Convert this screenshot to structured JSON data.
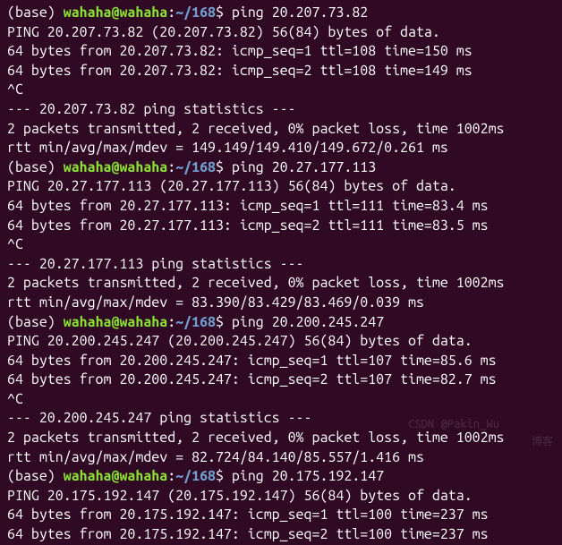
{
  "prompt": {
    "env": "(base) ",
    "user": "wahaha@wahaha",
    "colon": ":",
    "path": "~/168",
    "dollar": "$ "
  },
  "sessions": [
    {
      "cmd": "ping 20.207.73.82",
      "header": "PING 20.207.73.82 (20.207.73.82) 56(84) bytes of data.",
      "replies": [
        "64 bytes from 20.207.73.82: icmp_seq=1 ttl=108 time=150 ms",
        "64 bytes from 20.207.73.82: icmp_seq=2 ttl=108 time=149 ms"
      ],
      "ctrlc": "^C",
      "stats_header": "--- 20.207.73.82 ping statistics ---",
      "stats_summary": "2 packets transmitted, 2 received, 0% packet loss, time 1002ms",
      "rtt": "rtt min/avg/max/mdev = 149.149/149.410/149.672/0.261 ms"
    },
    {
      "cmd": "ping 20.27.177.113",
      "header": "PING 20.27.177.113 (20.27.177.113) 56(84) bytes of data.",
      "replies": [
        "64 bytes from 20.27.177.113: icmp_seq=1 ttl=111 time=83.4 ms",
        "64 bytes from 20.27.177.113: icmp_seq=2 ttl=111 time=83.5 ms"
      ],
      "ctrlc": "^C",
      "stats_header": "--- 20.27.177.113 ping statistics ---",
      "stats_summary": "2 packets transmitted, 2 received, 0% packet loss, time 1002ms",
      "rtt": "rtt min/avg/max/mdev = 83.390/83.429/83.469/0.039 ms"
    },
    {
      "cmd": "ping 20.200.245.247",
      "header": "PING 20.200.245.247 (20.200.245.247) 56(84) bytes of data.",
      "replies": [
        "64 bytes from 20.200.245.247: icmp_seq=1 ttl=107 time=85.6 ms",
        "64 bytes from 20.200.245.247: icmp_seq=2 ttl=107 time=82.7 ms"
      ],
      "ctrlc": "^C",
      "stats_header": "--- 20.200.245.247 ping statistics ---",
      "stats_summary": "2 packets transmitted, 2 received, 0% packet loss, time 1002ms",
      "rtt": "rtt min/avg/max/mdev = 82.724/84.140/85.557/1.416 ms"
    },
    {
      "cmd": "ping 20.175.192.147",
      "header": "PING 20.175.192.147 (20.175.192.147) 56(84) bytes of data.",
      "replies": [
        "64 bytes from 20.175.192.147: icmp_seq=1 ttl=100 time=237 ms",
        "64 bytes from 20.175.192.147: icmp_seq=2 ttl=100 time=237 ms"
      ],
      "ctrlc": "",
      "stats_header": "",
      "stats_summary": "",
      "rtt": ""
    }
  ],
  "watermarks": {
    "w1": "CSDN @Pakin_Wu",
    "w2": "博客"
  }
}
